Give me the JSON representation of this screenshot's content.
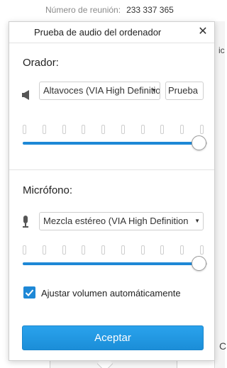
{
  "background": {
    "meeting_number_label": "Número de reunión:",
    "meeting_number": "233 337 365",
    "right_fragment_text": "ic",
    "right_bottom_fragment": "C"
  },
  "popup": {
    "title": "Prueba de audio del ordenador",
    "close_symbol": "✕",
    "speaker": {
      "label": "Orador:",
      "icon": "speaker-icon",
      "selected_device": "Altavoces (VIA High Definition",
      "test_label": "Prueba",
      "volume": 1.0,
      "level_segments": 10,
      "level_active": 0
    },
    "microphone": {
      "label": "Micrófono:",
      "icon": "microphone-icon",
      "selected_device": "Mezcla estéreo (VIA High Definition",
      "volume": 1.0,
      "level_segments": 10,
      "level_active": 0
    },
    "auto_adjust": {
      "checked": true,
      "label": "Ajustar volumen automáticamente"
    },
    "accept_label": "Aceptar"
  },
  "colors": {
    "accent": "#1e88d6",
    "border": "#cfcfcf"
  }
}
